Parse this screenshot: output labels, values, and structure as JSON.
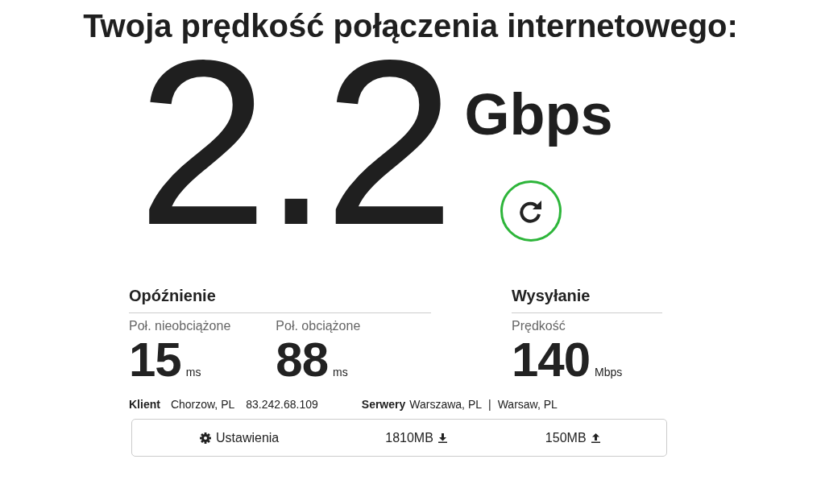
{
  "title": "Twoja prędkość połączenia internetowego:",
  "speed": {
    "value": "2.2",
    "unit": "Gbps"
  },
  "latency": {
    "heading": "Opóźnienie",
    "items": [
      {
        "label": "Poł. nieobciążone",
        "value": "15",
        "unit": "ms"
      },
      {
        "label": "Poł. obciążone",
        "value": "88",
        "unit": "ms"
      }
    ]
  },
  "upload": {
    "heading": "Wysyłanie",
    "items": [
      {
        "label": "Prędkość",
        "value": "140",
        "unit": "Mbps"
      }
    ]
  },
  "client": {
    "label": "Klient",
    "location": "Chorzow, PL",
    "ip": "83.242.68.109"
  },
  "servers": {
    "label": "Serwery",
    "primary": "Warszawa, PL",
    "separator": "|",
    "secondary": "Warsaw, PL"
  },
  "footer": {
    "settings": "Ustawienia",
    "downloaded": "1810MB",
    "uploaded": "150MB"
  }
}
